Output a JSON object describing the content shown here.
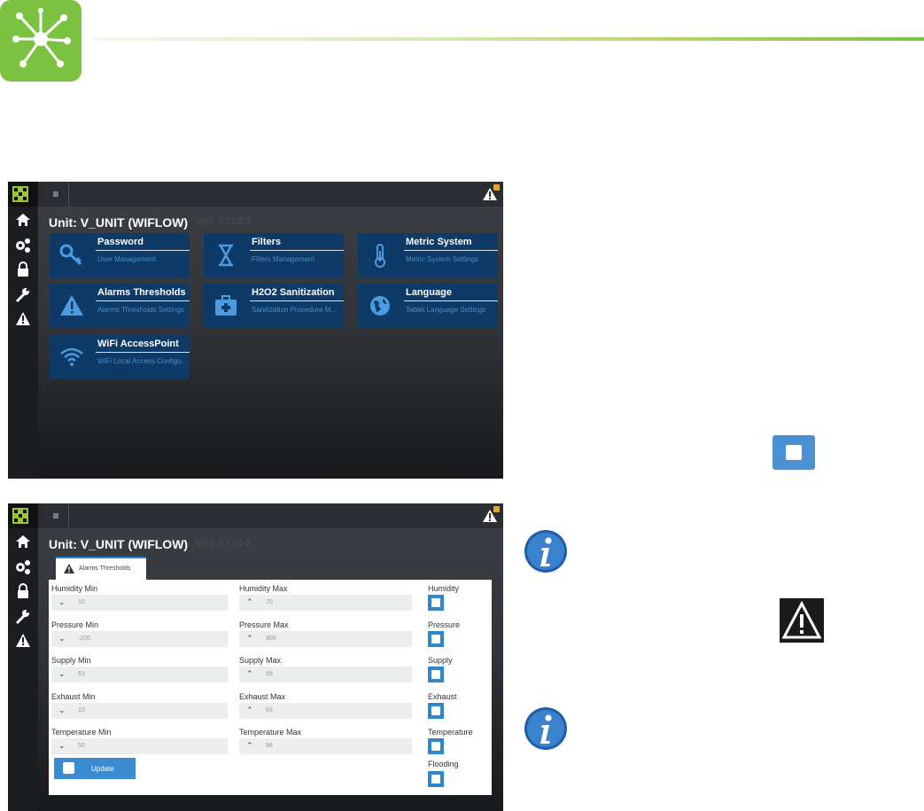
{
  "app": {
    "unit_title": "Unit: V_UNIT (WIFLOW)",
    "unit_subtitle": "Vers. 3.77.2-2"
  },
  "topbar": {
    "menu_glyph": "≡"
  },
  "sidebar": {
    "items": [
      {
        "name": "home",
        "icon": "home-icon"
      },
      {
        "name": "settings",
        "icon": "gears-icon"
      },
      {
        "name": "lock",
        "icon": "lock-icon"
      },
      {
        "name": "maintenance",
        "icon": "wrench-icon"
      },
      {
        "name": "alarms",
        "icon": "warning-icon"
      }
    ]
  },
  "tiles": [
    {
      "title": "Password",
      "subtitle": "User Management",
      "icon": "key-icon"
    },
    {
      "title": "Filters",
      "subtitle": "Filters Management",
      "icon": "hourglass-icon"
    },
    {
      "title": "Metric System",
      "subtitle": "Metric System Settings",
      "icon": "thermometer-icon"
    },
    {
      "title": "Alarms Thresholds",
      "subtitle": "Alarms Thresholds Settings",
      "icon": "warning-icon"
    },
    {
      "title": "H2O2 Sanitization",
      "subtitle": "Sanitization Procedure M...",
      "icon": "medkit-icon"
    },
    {
      "title": "Language",
      "subtitle": "Tablet Language Settings",
      "icon": "globe-icon"
    },
    {
      "title": "WiFi AccessPoint",
      "subtitle": "WiFi Local Access Configu...",
      "icon": "wifi-icon"
    }
  ],
  "thresholds": {
    "tab_label": "Alarms Thresholds",
    "min_fields": [
      {
        "label": "Humidity Min",
        "value": "10"
      },
      {
        "label": "Pressure Min",
        "value": "-200"
      },
      {
        "label": "Supply Min",
        "value": "63"
      },
      {
        "label": "Exhaust Min",
        "value": "10"
      },
      {
        "label": "Temperature Min",
        "value": "50"
      }
    ],
    "max_fields": [
      {
        "label": "Humidity Max",
        "value": "70"
      },
      {
        "label": "Pressure Max",
        "value": "800"
      },
      {
        "label": "Supply Max",
        "value": "99"
      },
      {
        "label": "Exhaust Max",
        "value": "83"
      },
      {
        "label": "Temperature Max",
        "value": "86"
      }
    ],
    "enables": [
      {
        "label": "Humidity",
        "checked": true
      },
      {
        "label": "Pressure",
        "checked": true
      },
      {
        "label": "Supply",
        "checked": true
      },
      {
        "label": "Exhaust",
        "checked": true
      },
      {
        "label": "Temperature",
        "checked": true
      },
      {
        "label": "Flooding",
        "checked": true
      }
    ],
    "update_label": "Update",
    "min_chevron": "⌄",
    "max_chevron": "⌃"
  },
  "colors": {
    "brand_green": "#7cc241",
    "tile_blue": "#0d3a66",
    "accent_blue": "#2f86c8",
    "badge_orange": "#f0a21a"
  }
}
